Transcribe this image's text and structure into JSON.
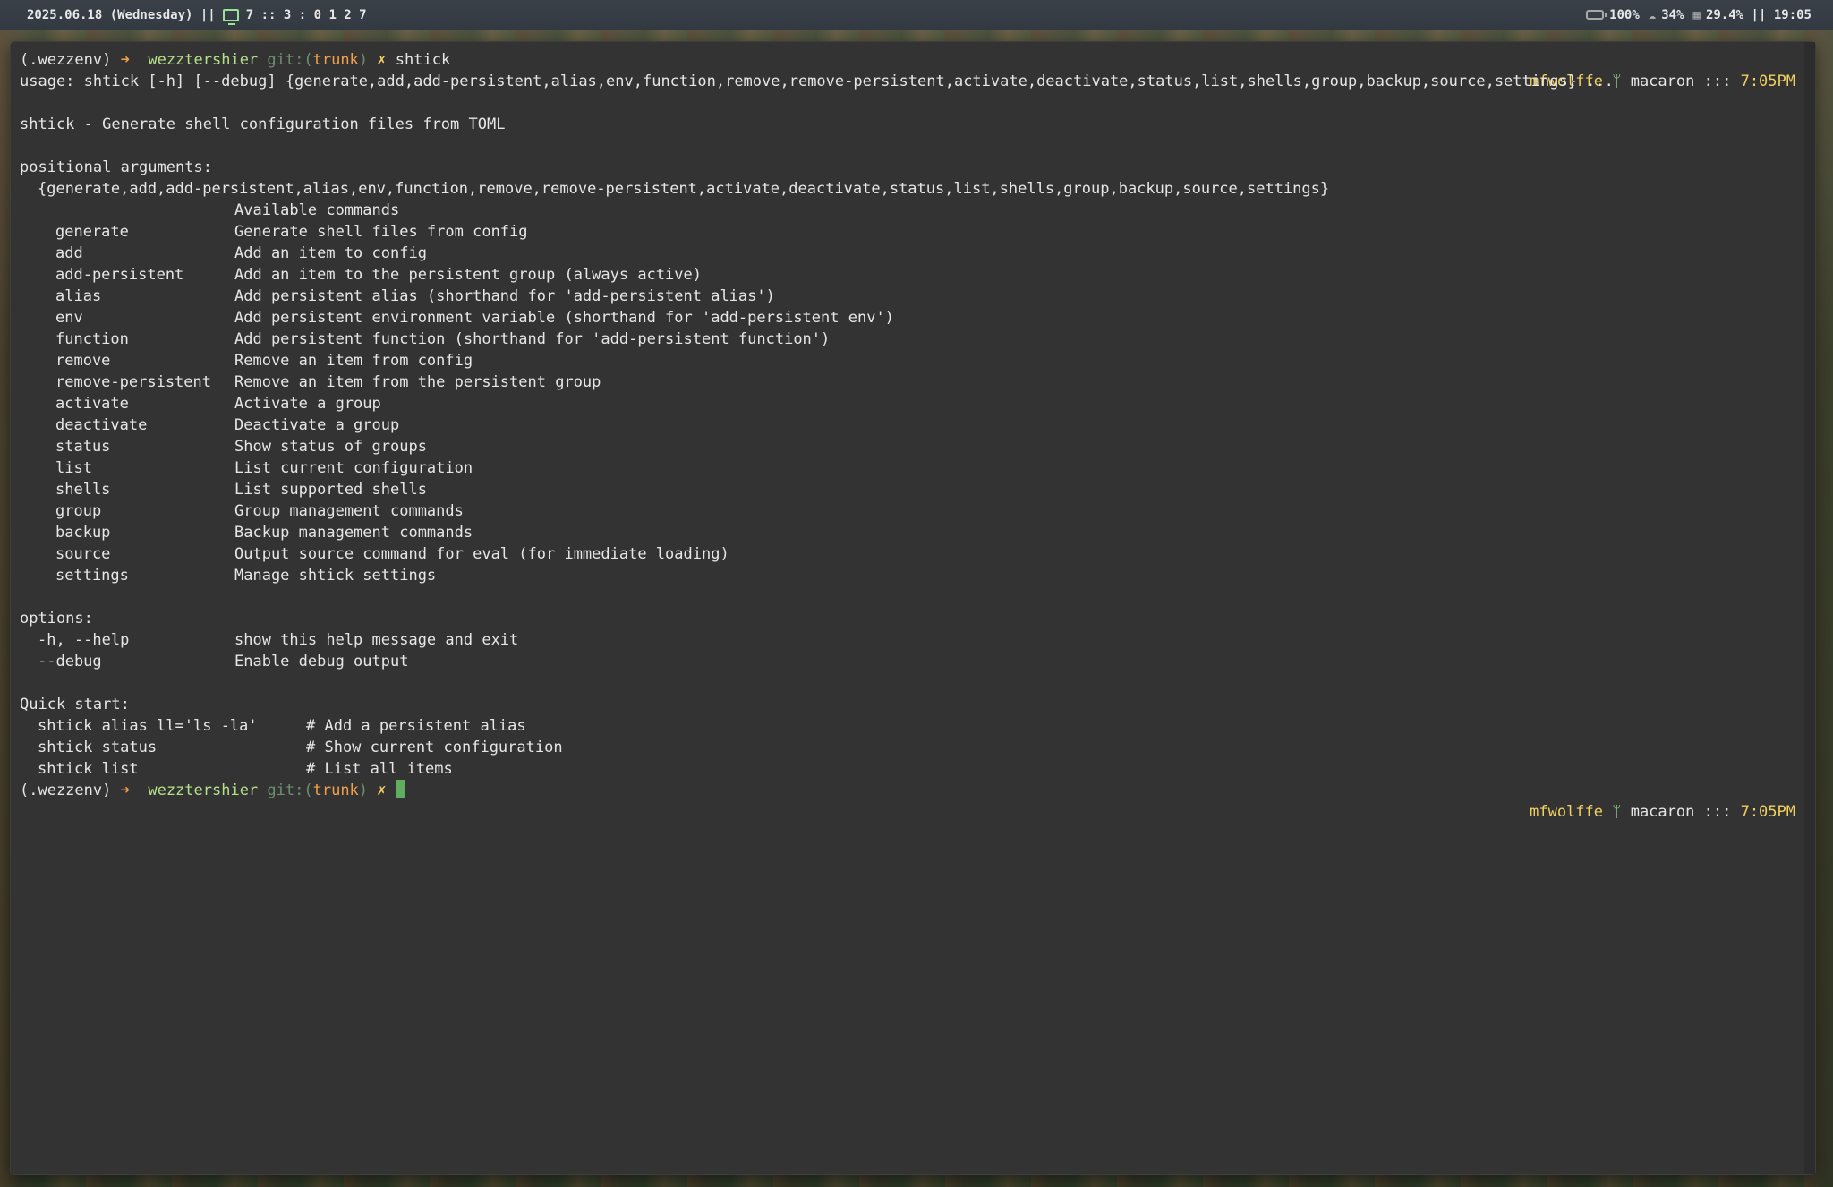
{
  "statusbar": {
    "date": "2025.06.18 (Wednesday)",
    "sep1": "||",
    "workspaces": "7 :: 3 : 0 1 2 7",
    "battery": "100%",
    "humidity": "34%",
    "cpu": "29.4%",
    "sep2": "||",
    "clock": "19:05"
  },
  "prompt": {
    "venv": "(.wezzenv)",
    "arrow": "➜",
    "dir": "wezztershier",
    "git_label": "git:(",
    "branch": "trunk",
    "git_close": ")",
    "dirty": "✗",
    "command": "shtick"
  },
  "rprompt": {
    "user": "mfwolffe",
    "fork_glyph": "ᛘ",
    "host": "macaron",
    "sep": ":::",
    "time": "7:05PM"
  },
  "output": {
    "usage": "usage: shtick [-h] [--debug] {generate,add,add-persistent,alias,env,function,remove,remove-persistent,activate,deactivate,status,list,shells,group,backup,source,settings} ...",
    "description": "shtick - Generate shell configuration files from TOML",
    "positional_header": "positional arguments:",
    "choices": "{generate,add,add-persistent,alias,env,function,remove,remove-persistent,activate,deactivate,status,list,shells,group,backup,source,settings}",
    "available": "Available commands",
    "commands": [
      {
        "name": "generate",
        "desc": "Generate shell files from config"
      },
      {
        "name": "add",
        "desc": "Add an item to config"
      },
      {
        "name": "add-persistent",
        "desc": "Add an item to the persistent group (always active)"
      },
      {
        "name": "alias",
        "desc": "Add persistent alias (shorthand for 'add-persistent alias')"
      },
      {
        "name": "env",
        "desc": "Add persistent environment variable (shorthand for 'add-persistent env')"
      },
      {
        "name": "function",
        "desc": "Add persistent function (shorthand for 'add-persistent function')"
      },
      {
        "name": "remove",
        "desc": "Remove an item from config"
      },
      {
        "name": "remove-persistent",
        "desc": "Remove an item from the persistent group"
      },
      {
        "name": "activate",
        "desc": "Activate a group"
      },
      {
        "name": "deactivate",
        "desc": "Deactivate a group"
      },
      {
        "name": "status",
        "desc": "Show status of groups"
      },
      {
        "name": "list",
        "desc": "List current configuration"
      },
      {
        "name": "shells",
        "desc": "List supported shells"
      },
      {
        "name": "group",
        "desc": "Group management commands"
      },
      {
        "name": "backup",
        "desc": "Backup management commands"
      },
      {
        "name": "source",
        "desc": "Output source command for eval (for immediate loading)"
      },
      {
        "name": "settings",
        "desc": "Manage shtick settings"
      }
    ],
    "options_header": "options:",
    "options": [
      {
        "name": "-h, --help",
        "desc": "show this help message and exit"
      },
      {
        "name": "--debug",
        "desc": "Enable debug output"
      }
    ],
    "quickstart_header": "Quick start:",
    "quickstart": [
      {
        "cmd": "shtick alias ll='ls -la'",
        "comment": "# Add a persistent alias"
      },
      {
        "cmd": "shtick status",
        "comment": "# Show current configuration"
      },
      {
        "cmd": "shtick list",
        "comment": "# List all items"
      }
    ]
  }
}
